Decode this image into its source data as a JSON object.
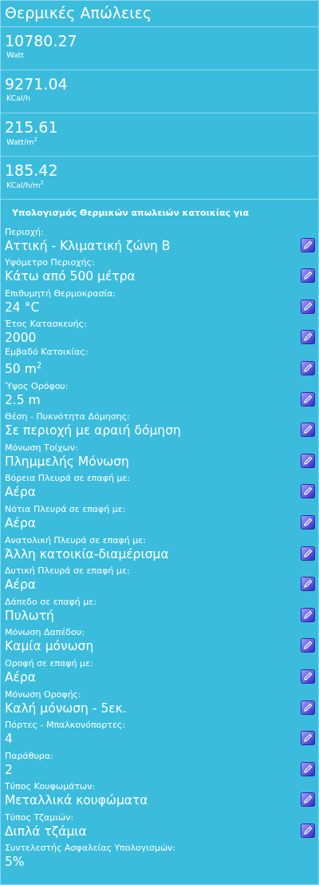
{
  "title": "Θερμικές Απώλειες",
  "results": [
    {
      "value": "10780.27",
      "unit": "Watt"
    },
    {
      "value": "9271.04",
      "unit": "KCal/h"
    },
    {
      "value": "215.61",
      "unit": "Watt/m$^{2}$"
    },
    {
      "value": "185.42",
      "unit": "KCal/h/m$^{2}$"
    }
  ],
  "section_heading": "Υπολογισμός Θερμικών απωλειών κατοικίας για",
  "parameters": [
    {
      "label": "Περιοχή:",
      "value": "Αττική - Κλιματική ζώνη Β",
      "editable": true
    },
    {
      "label": "Υψόμετρο Περιοχής:",
      "value": "Κάτω από 500 μέτρα",
      "editable": true
    },
    {
      "label": "Επιθυμητή Θερμοκρασία:",
      "value": "24 °C",
      "editable": true
    },
    {
      "label": "Έτος Κατασκευής:",
      "value": "2000",
      "editable": true
    },
    {
      "label": "Εμβαδό Κατοικίας:",
      "value": "50 m$^{2}$",
      "editable": true
    },
    {
      "label": "Ύψος Ορόφου:",
      "value": "2.5 m",
      "editable": true
    },
    {
      "label": "Θέση - Πυκνότητα Δόμησης:",
      "value": "Σε περιοχή με αραιή δόμηση",
      "editable": true
    },
    {
      "label": "Μόνωση Τοίχων:",
      "value": "Πλημμελής Μόνωση",
      "editable": true
    },
    {
      "label": "Βόρεια Πλευρά σε επαφή με:",
      "value": "Αέρα",
      "editable": true
    },
    {
      "label": "Νότια Πλευρά σε επαφή με:",
      "value": "Αέρα",
      "editable": true
    },
    {
      "label": "Ανατολική Πλευρά σε επαφή με:",
      "value": "Άλλη κατοικία-διαμέρισμα",
      "editable": true
    },
    {
      "label": "Δυτική Πλευρά σε επαφή με:",
      "value": "Αέρα",
      "editable": true
    },
    {
      "label": "Δάπεδο σε επαφή με:",
      "value": "Πυλωτή",
      "editable": true
    },
    {
      "label": "Μόνωση Δαπέδου:",
      "value": "Καμία μόνωση",
      "editable": true
    },
    {
      "label": "Οροφή σε επαφή με:",
      "value": "Αέρα",
      "editable": true
    },
    {
      "label": "Μόνωση Οροφής:",
      "value": "Καλή μόνωση - 5εκ.",
      "editable": true
    },
    {
      "label": "Πόρτες - Μπαλκονόπορτες:",
      "value": "4",
      "editable": true
    },
    {
      "label": "Παράθυρα:",
      "value": "2",
      "editable": true
    },
    {
      "label": "Τύπος Κουφωμάτων:",
      "value": "Μεταλλικά κουφώματα",
      "editable": true
    },
    {
      "label": "Τύπος Τζαμιών:",
      "value": "Διπλά τζάμια",
      "editable": true
    },
    {
      "label": "Συντελεστής Ασφαλείας Υπολογισμών:",
      "value": "5%",
      "editable": false
    }
  ]
}
